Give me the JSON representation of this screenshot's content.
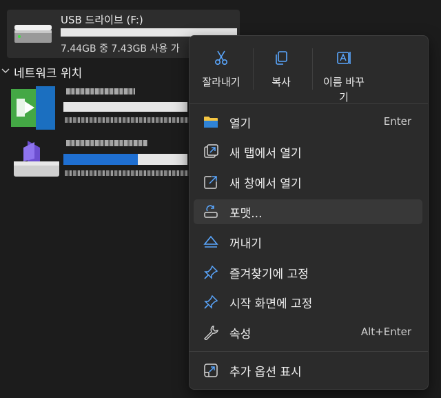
{
  "drive": {
    "name": "USB 드라이브 (F:)",
    "space": "7.44GB 중 7.43GB 사용 가",
    "icon": "drive-icon"
  },
  "network": {
    "title": "네트워크 위치"
  },
  "context_menu": {
    "quick_actions": [
      {
        "label": "잘라내기",
        "icon": "scissors-icon"
      },
      {
        "label": "복사",
        "icon": "copy-icon"
      },
      {
        "label": "이름 바꾸\n기",
        "icon": "rename-icon"
      }
    ],
    "items": [
      {
        "label": "열기",
        "shortcut": "Enter",
        "icon": "folder-icon"
      },
      {
        "label": "새 탭에서 열기",
        "icon": "new-tab-icon"
      },
      {
        "label": "새 창에서 열기",
        "icon": "new-window-icon"
      },
      {
        "label": "포맷...",
        "icon": "format-icon"
      },
      {
        "label": "꺼내기",
        "icon": "eject-icon"
      },
      {
        "label": "즐겨찾기에 고정",
        "icon": "pin-icon"
      },
      {
        "label": "시작 화면에 고정",
        "icon": "pin-icon"
      },
      {
        "label": "속성",
        "shortcut": "Alt+Enter",
        "icon": "wrench-icon"
      },
      {
        "label": "추가 옵션 표시",
        "icon": "more-options-icon"
      }
    ]
  },
  "colors": {
    "accent": "#1f6fd1",
    "icon_blue": "#5aa7ff",
    "folder_yellow": "#f4c542",
    "background": "#1c1c1c",
    "menu_bg": "#2b2b2b"
  }
}
